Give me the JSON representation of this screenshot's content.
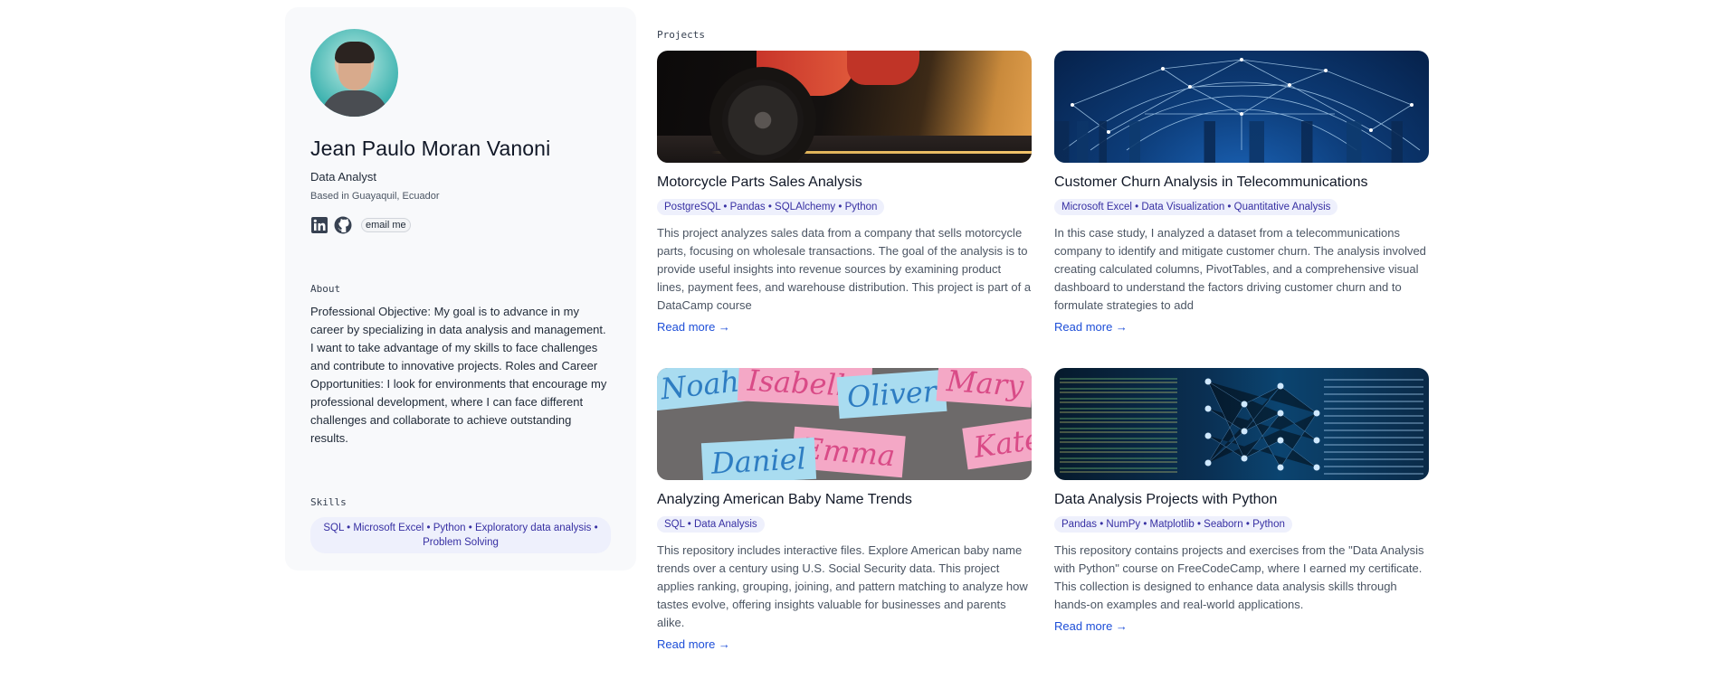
{
  "profile": {
    "name": "Jean Paulo Moran Vanoni",
    "role": "Data Analyst",
    "location": "Based in Guayaquil, Ecuador",
    "email_label": "email me",
    "about_label": "About",
    "about_text": "Professional Objective: My goal is to advance in my career by specializing in data analysis and management. I want to take advantage of my skills to face challenges and contribute to innovative projects. Roles and Career Opportunities: I look for environments that encourage my professional development, where I can face different challenges and collaborate to achieve outstanding results.",
    "skills_label": "Skills",
    "skills": "SQL • Microsoft Excel • Python • Exploratory data analysis • Problem Solving"
  },
  "projects": {
    "label": "Projects",
    "items": [
      {
        "title": "Motorcycle Parts Sales Analysis",
        "tags": "PostgreSQL • Pandas • SQLAlchemy • Python",
        "description": "This project analyzes sales data from a company that sells motorcycle parts, focusing on wholesale transactions. The goal of the analysis is to provide useful insights into revenue sources by examining product lines, payment fees, and warehouse distribution. This project is part of a DataCamp course",
        "link": "Read more →"
      },
      {
        "title": "Customer Churn Analysis in Telecommunications",
        "tags": "Microsoft Excel • Data Visualization • Quantitative Analysis",
        "description": "In this case study, I analyzed a dataset from a telecommunications company to identify and mitigate customer churn. The analysis involved creating calculated columns, PivotTables, and a comprehensive visual dashboard to understand the factors driving customer churn and to formulate strategies to add",
        "link": "Read more →"
      },
      {
        "title": "Analyzing American Baby Name Trends",
        "tags": "SQL • Data Analysis",
        "description": "This repository includes interactive files. Explore American baby name trends over a century using U.S. Social Security data. This project applies ranking, grouping, joining, and pattern matching to analyze how tastes evolve, offering insights valuable for businesses and parents alike.",
        "link": "Read more →",
        "image_words": [
          "Noah",
          "Isabella",
          "Oliver",
          "Mary",
          "Emma",
          "Daniel",
          "Kate"
        ]
      },
      {
        "title": "Data Analysis Projects with Python",
        "tags": "Pandas • NumPy • Matplotlib • Seaborn • Python",
        "description": "This repository contains projects and exercises from the \"Data Analysis with Python\" course on FreeCodeCamp, where I earned my certificate. This collection is designed to enhance data analysis skills through hands-on examples and real-world applications.",
        "link": "Read more →"
      }
    ]
  },
  "icons": {
    "linkedin": "linkedin-icon",
    "github": "github-icon"
  },
  "colors": {
    "accent_link": "#1d4ed8",
    "chip_bg": "#eef0fc",
    "chip_text": "#3730a3",
    "sidebar_bg": "#f8f9fb"
  }
}
